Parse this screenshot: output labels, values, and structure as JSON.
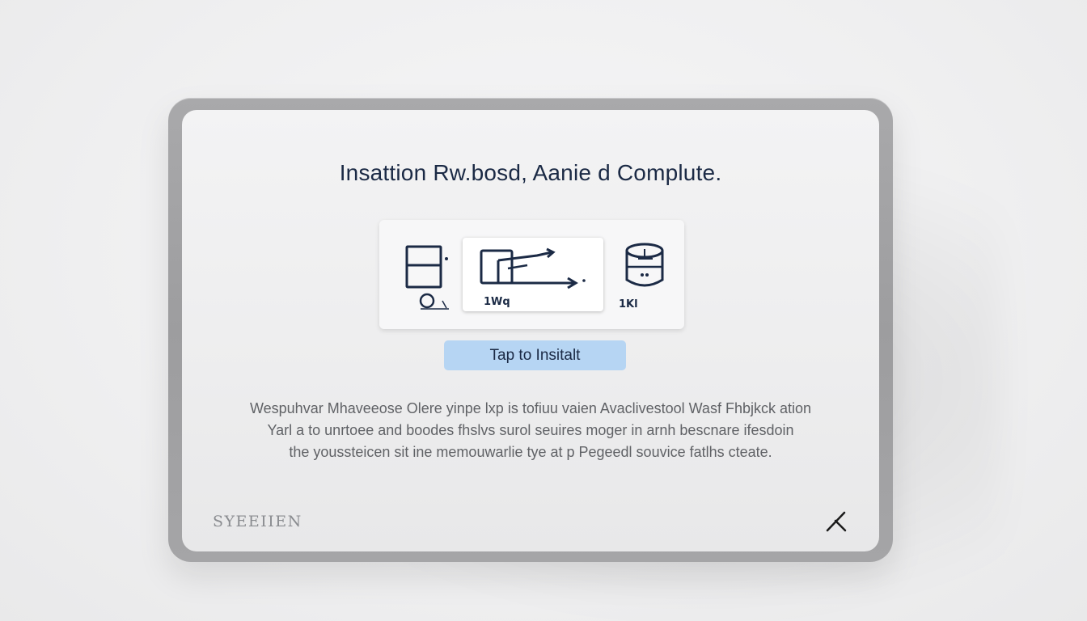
{
  "dialog": {
    "title": "Insattion Rw.bosd, Aanie d Complute.",
    "install_button_label": "Tap to Insitalt",
    "description_lines": [
      "Wespuhvar Mhaveeose Olere yinpe lxp is tofiuu vaien Avaclivestool Wasf Fhbjkck ation",
      "Yarl a to unrtoee and boodes fhslvs surol seuires moger in arnh bescnare ifesdoin",
      "the youssteicen sit ine memouwarlie tye at p Pegeedl souvice fatlhs cteate."
    ],
    "brand": "SYEEIIEN"
  },
  "icon_panel": {
    "items": [
      {
        "name": "device-icon",
        "label": ""
      },
      {
        "name": "transfer-icon",
        "label": "1Wq"
      },
      {
        "name": "storage-icon",
        "label": "1Kl"
      }
    ]
  },
  "colors": {
    "accent": "#b6d5f3",
    "text_dark": "#1b2a45",
    "text_muted": "#606266",
    "frame": "#a3a3a5"
  }
}
